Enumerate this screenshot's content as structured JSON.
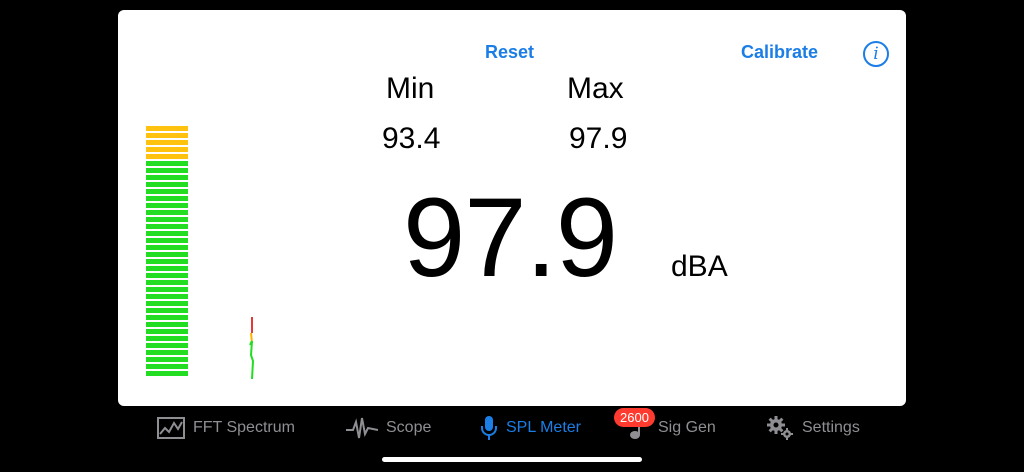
{
  "header": {
    "reset_label": "Reset",
    "calibrate_label": "Calibrate",
    "info_icon": "info-icon"
  },
  "readings": {
    "min_label": "Min",
    "max_label": "Max",
    "min_value": "93.4",
    "max_value": "97.9",
    "current_value": "97.9",
    "unit": "dBA"
  },
  "level_meter": {
    "yellow_segments": 5,
    "green_segments": 31,
    "colors": {
      "yellow": "#ffc20e",
      "green": "#22dd22"
    }
  },
  "tabs": [
    {
      "label": "FFT Spectrum",
      "icon": "spectrum-icon"
    },
    {
      "label": "Scope",
      "icon": "waveform-icon"
    },
    {
      "label": "SPL Meter",
      "icon": "microphone-icon",
      "active": true
    },
    {
      "label": "Sig Gen",
      "icon": "music-note-icon",
      "badge": "2600"
    },
    {
      "label": "Settings",
      "icon": "gear-icon"
    }
  ],
  "colors": {
    "accent": "#1a7ee6",
    "inactive": "#8e8e93",
    "badge": "#ff3b30"
  }
}
